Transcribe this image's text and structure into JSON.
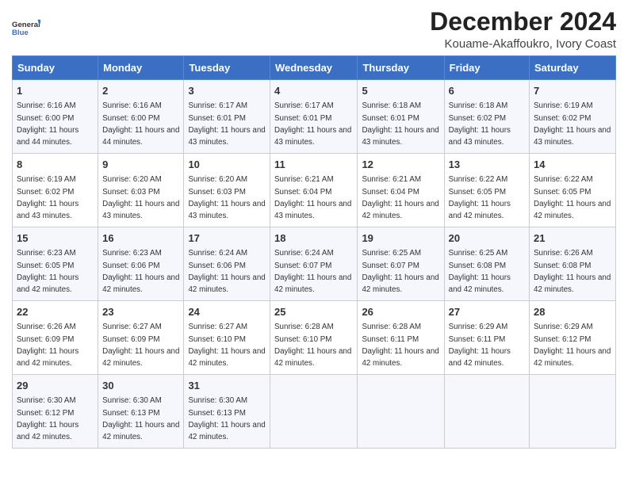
{
  "logo": {
    "line1": "General",
    "line2": "Blue"
  },
  "title": "December 2024",
  "subtitle": "Kouame-Akaffoukro, Ivory Coast",
  "days_of_week": [
    "Sunday",
    "Monday",
    "Tuesday",
    "Wednesday",
    "Thursday",
    "Friday",
    "Saturday"
  ],
  "weeks": [
    [
      {
        "day": "1",
        "sunrise": "6:16 AM",
        "sunset": "6:00 PM",
        "daylight": "11 hours and 44 minutes."
      },
      {
        "day": "2",
        "sunrise": "6:16 AM",
        "sunset": "6:00 PM",
        "daylight": "11 hours and 44 minutes."
      },
      {
        "day": "3",
        "sunrise": "6:17 AM",
        "sunset": "6:01 PM",
        "daylight": "11 hours and 43 minutes."
      },
      {
        "day": "4",
        "sunrise": "6:17 AM",
        "sunset": "6:01 PM",
        "daylight": "11 hours and 43 minutes."
      },
      {
        "day": "5",
        "sunrise": "6:18 AM",
        "sunset": "6:01 PM",
        "daylight": "11 hours and 43 minutes."
      },
      {
        "day": "6",
        "sunrise": "6:18 AM",
        "sunset": "6:02 PM",
        "daylight": "11 hours and 43 minutes."
      },
      {
        "day": "7",
        "sunrise": "6:19 AM",
        "sunset": "6:02 PM",
        "daylight": "11 hours and 43 minutes."
      }
    ],
    [
      {
        "day": "8",
        "sunrise": "6:19 AM",
        "sunset": "6:02 PM",
        "daylight": "11 hours and 43 minutes."
      },
      {
        "day": "9",
        "sunrise": "6:20 AM",
        "sunset": "6:03 PM",
        "daylight": "11 hours and 43 minutes."
      },
      {
        "day": "10",
        "sunrise": "6:20 AM",
        "sunset": "6:03 PM",
        "daylight": "11 hours and 43 minutes."
      },
      {
        "day": "11",
        "sunrise": "6:21 AM",
        "sunset": "6:04 PM",
        "daylight": "11 hours and 43 minutes."
      },
      {
        "day": "12",
        "sunrise": "6:21 AM",
        "sunset": "6:04 PM",
        "daylight": "11 hours and 42 minutes."
      },
      {
        "day": "13",
        "sunrise": "6:22 AM",
        "sunset": "6:05 PM",
        "daylight": "11 hours and 42 minutes."
      },
      {
        "day": "14",
        "sunrise": "6:22 AM",
        "sunset": "6:05 PM",
        "daylight": "11 hours and 42 minutes."
      }
    ],
    [
      {
        "day": "15",
        "sunrise": "6:23 AM",
        "sunset": "6:05 PM",
        "daylight": "11 hours and 42 minutes."
      },
      {
        "day": "16",
        "sunrise": "6:23 AM",
        "sunset": "6:06 PM",
        "daylight": "11 hours and 42 minutes."
      },
      {
        "day": "17",
        "sunrise": "6:24 AM",
        "sunset": "6:06 PM",
        "daylight": "11 hours and 42 minutes."
      },
      {
        "day": "18",
        "sunrise": "6:24 AM",
        "sunset": "6:07 PM",
        "daylight": "11 hours and 42 minutes."
      },
      {
        "day": "19",
        "sunrise": "6:25 AM",
        "sunset": "6:07 PM",
        "daylight": "11 hours and 42 minutes."
      },
      {
        "day": "20",
        "sunrise": "6:25 AM",
        "sunset": "6:08 PM",
        "daylight": "11 hours and 42 minutes."
      },
      {
        "day": "21",
        "sunrise": "6:26 AM",
        "sunset": "6:08 PM",
        "daylight": "11 hours and 42 minutes."
      }
    ],
    [
      {
        "day": "22",
        "sunrise": "6:26 AM",
        "sunset": "6:09 PM",
        "daylight": "11 hours and 42 minutes."
      },
      {
        "day": "23",
        "sunrise": "6:27 AM",
        "sunset": "6:09 PM",
        "daylight": "11 hours and 42 minutes."
      },
      {
        "day": "24",
        "sunrise": "6:27 AM",
        "sunset": "6:10 PM",
        "daylight": "11 hours and 42 minutes."
      },
      {
        "day": "25",
        "sunrise": "6:28 AM",
        "sunset": "6:10 PM",
        "daylight": "11 hours and 42 minutes."
      },
      {
        "day": "26",
        "sunrise": "6:28 AM",
        "sunset": "6:11 PM",
        "daylight": "11 hours and 42 minutes."
      },
      {
        "day": "27",
        "sunrise": "6:29 AM",
        "sunset": "6:11 PM",
        "daylight": "11 hours and 42 minutes."
      },
      {
        "day": "28",
        "sunrise": "6:29 AM",
        "sunset": "6:12 PM",
        "daylight": "11 hours and 42 minutes."
      }
    ],
    [
      {
        "day": "29",
        "sunrise": "6:30 AM",
        "sunset": "6:12 PM",
        "daylight": "11 hours and 42 minutes."
      },
      {
        "day": "30",
        "sunrise": "6:30 AM",
        "sunset": "6:13 PM",
        "daylight": "11 hours and 42 minutes."
      },
      {
        "day": "31",
        "sunrise": "6:30 AM",
        "sunset": "6:13 PM",
        "daylight": "11 hours and 42 minutes."
      },
      null,
      null,
      null,
      null
    ]
  ]
}
